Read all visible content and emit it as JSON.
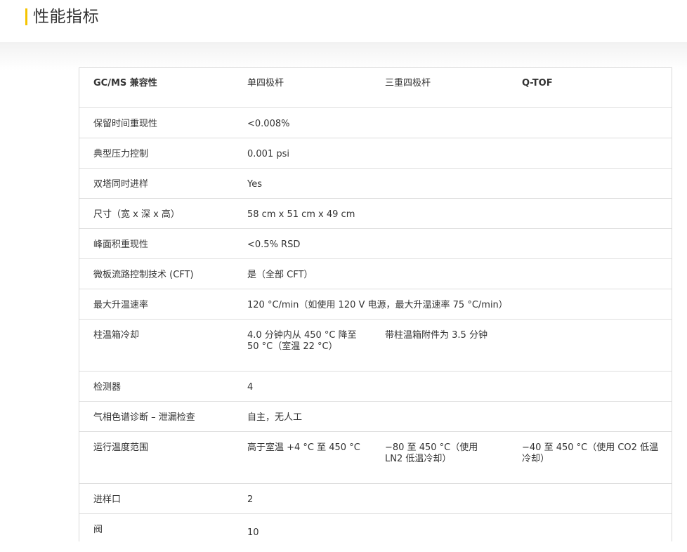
{
  "page": {
    "title": "性能指标",
    "accent_color": "#f5c400"
  },
  "table": {
    "header": [
      "GC/MS 兼容性",
      "单四极杆",
      "三重四极杆",
      "Q-TOF"
    ],
    "rows": [
      [
        "保留时间重现性",
        "<0.008%",
        "",
        ""
      ],
      [
        "典型压力控制",
        "0.001 psi",
        "",
        ""
      ],
      [
        "双塔同时进样",
        "Yes",
        "",
        ""
      ],
      [
        "尺寸（宽 x 深 x 高）",
        "58 cm x 51 cm x 49 cm",
        "",
        ""
      ],
      [
        "峰面积重现性",
        "<0.5% RSD",
        "",
        ""
      ],
      [
        "微板流路控制技术 (CFT)",
        "是（全部 CFT）",
        "",
        ""
      ],
      [
        "最大升温速率",
        "120 °C/min（如使用 120 V 电源，最大升温速率 75 °C/min）",
        "",
        ""
      ],
      [
        "柱温箱冷却",
        "4.0 分钟内从 450 °C 降至 50 °C（室温 22 °C）",
        "带柱温箱附件为 3.5 分钟",
        ""
      ],
      [
        "检测器",
        "4",
        "",
        ""
      ],
      [
        "气相色谱诊断 – 泄漏检查",
        "自主，无人工",
        "",
        ""
      ],
      [
        "运行温度范围",
        "高于室温 +4 °C 至 450 °C",
        "−80 至 450 °C（使用 LN2 低温冷却）",
        "−40 至 450 °C（使用 CO2 低温冷却）"
      ],
      [
        "进样口",
        "2",
        "",
        ""
      ],
      [
        "阀",
        "10",
        "",
        ""
      ]
    ]
  }
}
